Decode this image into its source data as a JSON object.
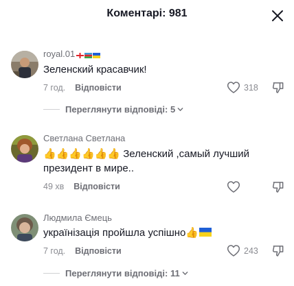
{
  "header": {
    "title": "Коментарі: 981"
  },
  "comments": [
    {
      "author": "royal.01",
      "text": "Зеленский красавчик!",
      "time": "7 год.",
      "reply_label": "Відповісти",
      "likes": "318",
      "view_replies": "Переглянути відповіді: 5"
    },
    {
      "author": "Светлана Светлана",
      "text": "👍👍👍👍👍👍 Зеленский ,самый лучший президент в мире..",
      "time": "49 хв",
      "reply_label": "Відповісти",
      "likes": ""
    },
    {
      "author": "Людмила Ємець",
      "text": "українізація пройшла успішно👍",
      "time": "7 год.",
      "reply_label": "Відповісти",
      "likes": "243",
      "view_replies": "Переглянути відповіді: 11"
    }
  ],
  "icons": {
    "close": "close-icon",
    "like": "heart-outline-icon",
    "dislike": "thumb-down-icon",
    "chevron": "chevron-down-icon",
    "flag_georgia": "georgia-flag-icon",
    "flag_azerbaijan": "azerbaijan-flag-icon",
    "flag_ukraine": "ukraine-flag-icon"
  },
  "colors": {
    "text_primary": "#161823",
    "text_secondary": "#8a8b91",
    "flag_ukraine_blue": "#1f5fd6",
    "flag_ukraine_yellow": "#f7d21c"
  }
}
